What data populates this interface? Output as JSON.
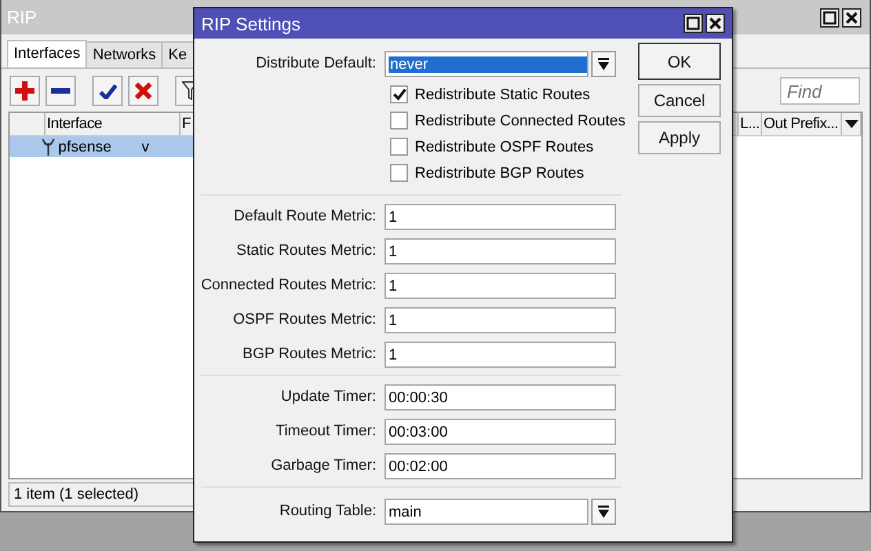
{
  "main_window": {
    "title": "RIP",
    "tabs": [
      {
        "label": "Interfaces",
        "selected": true
      },
      {
        "label": "Networks",
        "selected": false
      },
      {
        "label": "Ke",
        "selected": false
      }
    ],
    "find": {
      "placeholder": "Find"
    },
    "table": {
      "columns": [
        "Interface",
        "F",
        "L...",
        "Out Prefix..."
      ],
      "rows": [
        {
          "cells": [
            "pfsense",
            "v"
          ],
          "selected": true
        }
      ]
    },
    "status_bar": "1 item (1 selected)"
  },
  "dialog": {
    "title": "RIP Settings",
    "distribute_default": {
      "label": "Distribute Default:",
      "value": "never"
    },
    "redistribute": [
      {
        "label": "Redistribute Static Routes",
        "checked": true
      },
      {
        "label": "Redistribute Connected Routes",
        "checked": false
      },
      {
        "label": "Redistribute OSPF Routes",
        "checked": false
      },
      {
        "label": "Redistribute BGP Routes",
        "checked": false
      }
    ],
    "metrics": [
      {
        "label": "Default Route Metric:",
        "value": "1"
      },
      {
        "label": "Static Routes Metric:",
        "value": "1"
      },
      {
        "label": "Connected Routes Metric:",
        "value": "1"
      },
      {
        "label": "OSPF Routes Metric:",
        "value": "1"
      },
      {
        "label": "BGP Routes Metric:",
        "value": "1"
      }
    ],
    "timers": [
      {
        "label": "Update Timer:",
        "value": "00:00:30"
      },
      {
        "label": "Timeout Timer:",
        "value": "00:03:00"
      },
      {
        "label": "Garbage Timer:",
        "value": "00:02:00"
      }
    ],
    "routing_table": {
      "label": "Routing Table:",
      "value": "main"
    },
    "buttons": [
      "OK",
      "Cancel",
      "Apply"
    ]
  }
}
